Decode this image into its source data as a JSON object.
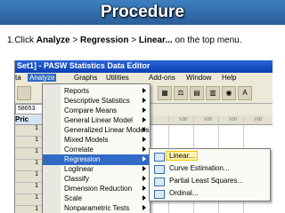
{
  "slide": {
    "title": "Procedure",
    "instruction": {
      "prefix": "1.Click ",
      "p1": "Analyze",
      "sep1": " > ",
      "p2": "Regression",
      "sep2": " > ",
      "p3": "Linear...",
      "suffix": " on the top menu."
    }
  },
  "window": {
    "title": "Set1] - PASW Statistics Data Editor",
    "menubar": [
      "ta",
      "Analyze",
      "Graphs",
      "Utilities",
      "Add-ons",
      "Window",
      "Help"
    ],
    "active_menu": "Analyze"
  },
  "grid": {
    "cell_ref": "58653",
    "first_col": "Pric",
    "headers": [
      "var",
      "var",
      "var",
      "var"
    ],
    "rows": [
      "1",
      "1",
      "1",
      "1",
      "1",
      "1",
      "1",
      "1"
    ]
  },
  "analyze_menu": {
    "items": [
      "Reports",
      "Descriptive Statistics",
      "Compare Means",
      "General Linear Model",
      "Generalized Linear Models",
      "Mixed Models",
      "Correlate",
      "Regression",
      "Loglinear",
      "Classify",
      "Dimension Reduction",
      "Scale",
      "Nonparametric Tests"
    ],
    "selected": "Regression"
  },
  "regression_submenu": {
    "items": [
      "Linear...",
      "Curve Estimation...",
      "Partial Least Squares...",
      "Ordinal..."
    ],
    "highlighted": "Linear..."
  },
  "colors": {
    "selection": "#316ac5",
    "highlight_border": "#f2c200",
    "title_band": "#2a5f99"
  }
}
